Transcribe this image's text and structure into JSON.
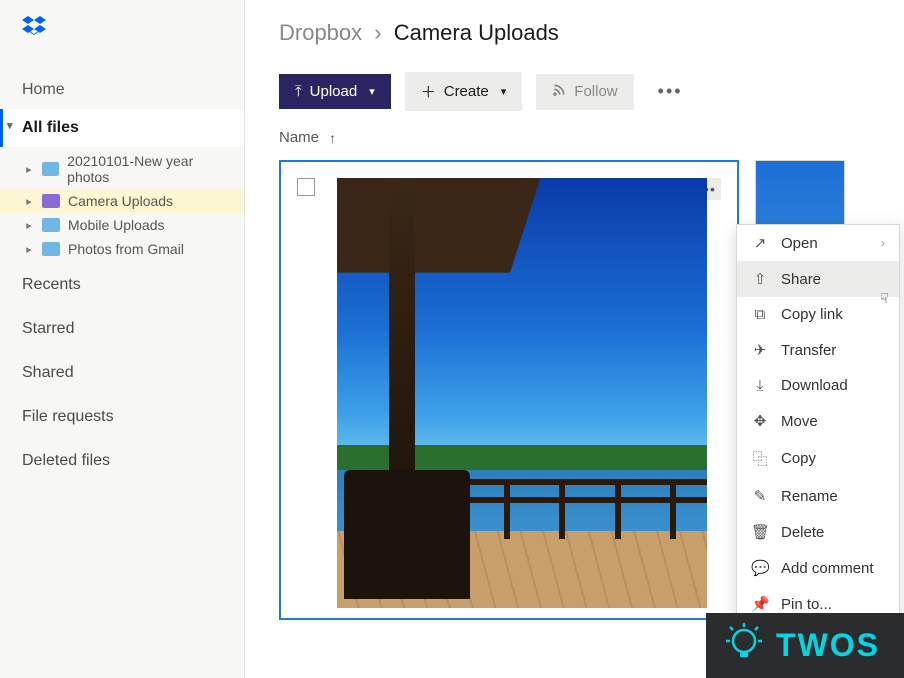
{
  "app": {
    "name": "Dropbox"
  },
  "sidebar": {
    "nav_home": "Home",
    "nav_allfiles": "All files",
    "folders": [
      {
        "label": "20210101-New year photos"
      },
      {
        "label": "Camera Uploads"
      },
      {
        "label": "Mobile Uploads"
      },
      {
        "label": "Photos from Gmail"
      }
    ],
    "sections": {
      "recents": "Recents",
      "starred": "Starred",
      "shared": "Shared",
      "file_requests": "File requests",
      "deleted": "Deleted files"
    }
  },
  "breadcrumb": {
    "root": "Dropbox",
    "current": "Camera Uploads"
  },
  "toolbar": {
    "upload": "Upload",
    "create": "Create",
    "follow": "Follow"
  },
  "columns": {
    "name": "Name"
  },
  "context_menu": {
    "open": "Open",
    "share": "Share",
    "copy_link": "Copy link",
    "transfer": "Transfer",
    "download": "Download",
    "move": "Move",
    "copy": "Copy",
    "rename": "Rename",
    "delete": "Delete",
    "add_comment": "Add comment",
    "pin_to": "Pin to..."
  },
  "watermark": {
    "text": "TWOS"
  }
}
